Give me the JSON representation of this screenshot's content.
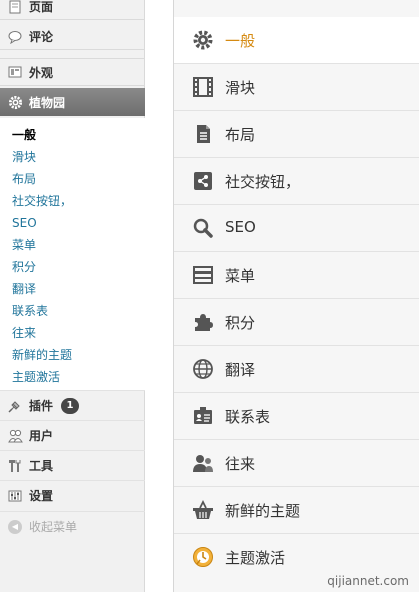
{
  "sidebar": {
    "top_items": [
      {
        "label": "页面",
        "icon": "page-icon"
      },
      {
        "label": "评论",
        "icon": "comment-icon"
      },
      {
        "label": "外观",
        "icon": "appearance-icon"
      }
    ],
    "active_item": {
      "label": "植物园",
      "icon": "gear-icon"
    },
    "submenu": [
      "一般",
      "滑块",
      "布局",
      "社交按钮，",
      "SEO",
      "菜单",
      "积分",
      "翻译",
      "联系表",
      "往来",
      "新鲜的主题",
      "主题激活"
    ],
    "submenu_current": "一般",
    "bottom_items": [
      {
        "label": "插件",
        "icon": "plugin-icon",
        "badge": "1"
      },
      {
        "label": "用户",
        "icon": "users-icon"
      },
      {
        "label": "工具",
        "icon": "tools-icon"
      },
      {
        "label": "设置",
        "icon": "settings-icon"
      }
    ],
    "collapse_label": "收起菜单"
  },
  "panel": {
    "tabs": [
      {
        "label": "一般",
        "icon": "gear-icon"
      },
      {
        "label": "滑块",
        "icon": "film-icon"
      },
      {
        "label": "布局",
        "icon": "document-icon"
      },
      {
        "label": "社交按钮，",
        "icon": "share-icon"
      },
      {
        "label": "SEO",
        "icon": "search-icon"
      },
      {
        "label": "菜单",
        "icon": "menu-icon"
      },
      {
        "label": "积分",
        "icon": "puzzle-icon"
      },
      {
        "label": "翻译",
        "icon": "globe-icon"
      },
      {
        "label": "联系表",
        "icon": "contact-card-icon"
      },
      {
        "label": "往来",
        "icon": "people-icon"
      },
      {
        "label": "新鲜的主题",
        "icon": "basket-icon"
      },
      {
        "label": "主题激活",
        "icon": "activation-icon"
      }
    ]
  },
  "watermark": "qijiannet.com",
  "colors": {
    "active_tab_text": "#d58a12",
    "link": "#21759b",
    "active_nav_bg": "#7a7a7a"
  }
}
